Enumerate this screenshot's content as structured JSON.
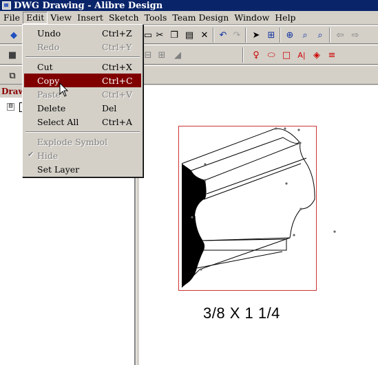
{
  "window": {
    "title": "DWG Drawing - Alibre Design"
  },
  "menubar": [
    {
      "label": "File"
    },
    {
      "label": "Edit"
    },
    {
      "label": "View"
    },
    {
      "label": "Insert"
    },
    {
      "label": "Sketch"
    },
    {
      "label": "Tools"
    },
    {
      "label": "Team Design"
    },
    {
      "label": "Window"
    },
    {
      "label": "Help"
    }
  ],
  "edit_menu": {
    "groups": [
      [
        {
          "label": "Undo",
          "shortcut": "Ctrl+Z",
          "enabled": true
        },
        {
          "label": "Redo",
          "shortcut": "Ctrl+Y",
          "enabled": false
        }
      ],
      [
        {
          "label": "Cut",
          "shortcut": "Ctrl+X",
          "enabled": true
        },
        {
          "label": "Copy",
          "shortcut": "Ctrl+C",
          "enabled": true,
          "highlighted": true
        },
        {
          "label": "Paste",
          "shortcut": "Ctrl+V",
          "enabled": false
        },
        {
          "label": "Delete",
          "shortcut": "Del",
          "enabled": true
        },
        {
          "label": "Select All",
          "shortcut": "Ctrl+A",
          "enabled": true
        }
      ],
      [
        {
          "label": "Explode Symbol",
          "shortcut": "",
          "enabled": false
        },
        {
          "label": "Hide",
          "shortcut": "",
          "enabled": false,
          "checked": true
        },
        {
          "label": "Set Layer",
          "shortcut": "",
          "enabled": true
        }
      ]
    ]
  },
  "left_panel": {
    "title": "Drawi",
    "tree_expander": "⊟"
  },
  "drawing": {
    "dimension_label": "3/8 X 1 1/4"
  },
  "colors": {
    "title_bar": "#0a246a",
    "menu_highlight": "#800000",
    "selection_box": "#cc3333"
  }
}
